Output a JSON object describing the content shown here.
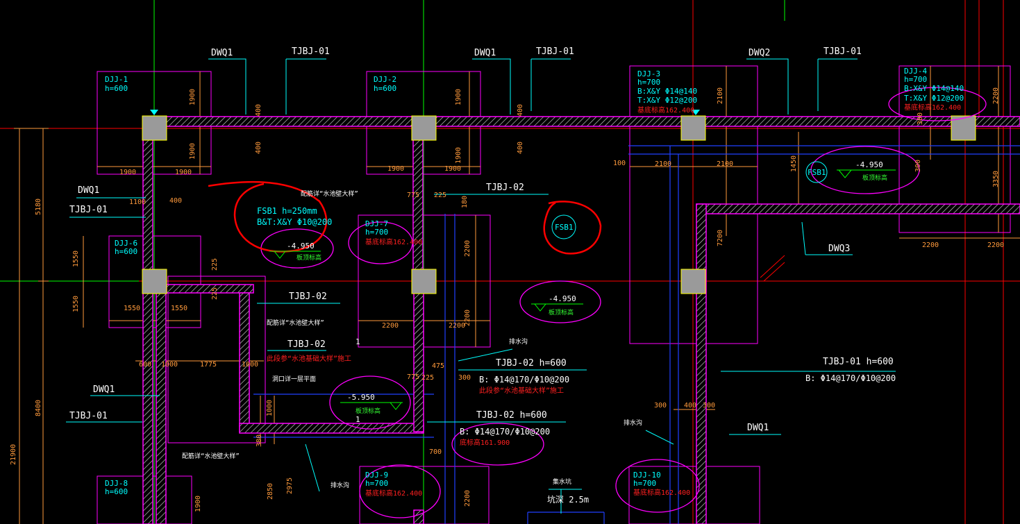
{
  "colors": {
    "background": "#000000",
    "wall": "#ff00ff",
    "axis_red": "#ff0000",
    "axis_green": "#00ff00",
    "dimension": "#ff9a3c",
    "annotation": "#00ffff",
    "column": "#9a9a9a",
    "pipe_blue": "#2040ff",
    "cloud": "#ff00ff",
    "markup": "#ff0000"
  },
  "labels": {
    "dwo1_a": "DWQ1",
    "tjbj01_a": "TJBJ-01",
    "dwo1_b": "DWQ1",
    "tjbj01_b": "TJBJ-01",
    "dwo2": "DWQ2",
    "tjbj01_c": "TJBJ-01",
    "dwo1_left": "DWQ1",
    "tjbj01_left": "TJBJ-01",
    "tjbj02_top": "TJBJ-02",
    "tjbj02_mid": "TJBJ-02",
    "tjbj02_mid2": "TJBJ-02",
    "dwo3": "DWQ3",
    "tjbj02_h600": "TJBJ-02  h=600",
    "tjbj02_h600_b": "B: Φ14@170/Φ10@200",
    "tjbj02_h600_2": "TJBJ-02  h=600",
    "tjbj02_h600_2b": "B: Φ14@170/Φ10@200",
    "tjbj01_h600": "TJBJ-01  h=600",
    "tjbj01_h600_b": "B: Φ14@170/Φ10@200",
    "dwo1_low": "DWQ1",
    "tjbj01_low": "TJBJ-01",
    "dwo1_right_low": "DWQ1",
    "pool_note_1": "配筋详“水池壁大样”",
    "pool_note_2": "配筋详“水池壁大样”",
    "pool_note_3": "配筋详“水池壁大样”",
    "hole_note": "洞口详一层平面",
    "drain_1": "排水沟",
    "drain_2": "排水沟",
    "drain_3": "排水沟",
    "sump": "集水坑",
    "sump_depth": "坑深 2.5m",
    "red_note_1": "此段参“水池基础大样”施工",
    "red_note_2": "此段参“水池基础大样”施工",
    "red_note_3": "底标高161.900"
  },
  "foundations": [
    {
      "name": "DJJ-1",
      "h": "h=600"
    },
    {
      "name": "DJJ-2",
      "h": "h=600"
    },
    {
      "name": "DJJ-3",
      "h": "h=700",
      "b": "B:X&Y  Φ14@140",
      "t": "T:X&Y  Φ12@200",
      "elev": "基底标高162.400"
    },
    {
      "name": "DJJ-4",
      "h": "h=700",
      "b": "B:X&Y  Φ14@140",
      "t": "T:X&Y  Φ12@200",
      "elev": "基底标高162.400"
    },
    {
      "name": "DJJ-6",
      "h": "h=600"
    },
    {
      "name": "DJJ-7",
      "h": "h=700",
      "elev": "基底标高162.400"
    },
    {
      "name": "DJJ-8",
      "h": "h=600"
    },
    {
      "name": "DJJ-9",
      "h": "h=700",
      "elev": "基底标高162.400"
    },
    {
      "name": "DJJ-10",
      "h": "h=700",
      "elev": "基底标高162.400"
    }
  ],
  "slabs": {
    "fsb1_title": "FSB1 h=250mm",
    "fsb1_rebar": "B&T:X&Y  Φ10@200",
    "fsb1_circle": "FSB1",
    "fsb1_circle_2": "FSB1"
  },
  "elevations": [
    {
      "value": "-4.950",
      "label": "板顶标高"
    },
    {
      "value": "-4.950",
      "label": "板顶标高"
    },
    {
      "value": "-4.950",
      "label": "板顶标高"
    },
    {
      "value": "-5.950",
      "label": "板顶标高"
    }
  ],
  "dimensions": {
    "d1900": "1900",
    "d400": "400",
    "d2100": "2100",
    "d2200": "2200",
    "d1550": "1550",
    "d5180": "5180",
    "d8400": "8400",
    "d21900": "21900",
    "d3350": "3350",
    "d7200": "7200",
    "d1450": "1450",
    "d300": "300",
    "d100": "100",
    "d1100": "1100",
    "d225": "225",
    "d600": "600",
    "d1775": "1775",
    "d1000": "1000",
    "d700": "700",
    "d2850": "2850",
    "d2975": "2975",
    "d380": "380",
    "d775": "775",
    "d475": "475",
    "d180": "180",
    "d1": "1"
  }
}
